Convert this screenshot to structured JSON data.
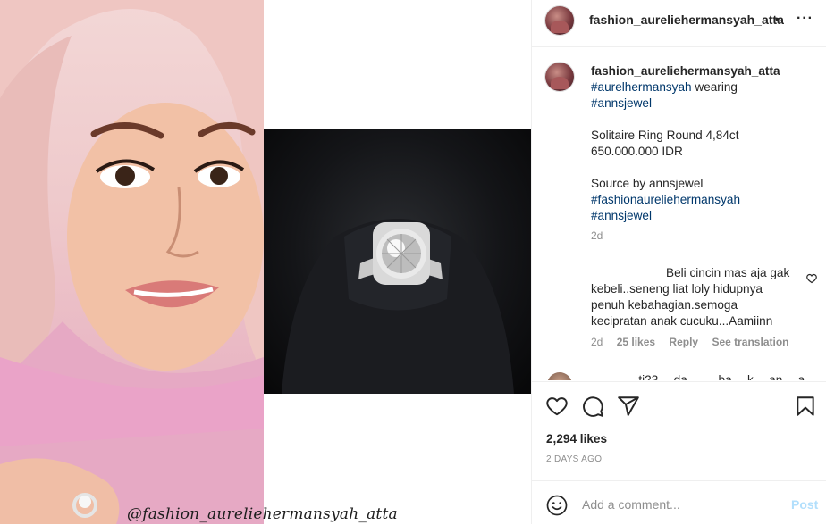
{
  "post": {
    "watermark": "@fashion_aureliehermansyah_atta"
  },
  "header": {
    "username": "fashion_aureliehermansyah_atta",
    "dot": "•",
    "more": "···"
  },
  "caption": {
    "username": "fashion_aureliehermansyah_atta",
    "line1_tag": "#aurelhermansyah",
    "line1_rest": " wearing",
    "line2_tag": "#annsjewel",
    "product": "Solitaire Ring Round 4,84ct",
    "price": "650.000.000 IDR",
    "source": "Source by annsjewel",
    "tag3": "#fashionaureliehermansyah",
    "tag4": "#annsjewel",
    "time": "2d"
  },
  "comment": {
    "line1": "Beli cincin mas aja gak",
    "line2": "kebeli..seneng liat loly hidupnya",
    "line3": "penuh kebahagian.semoga",
    "line4": "kecipratan anak cucuku...Aamiinn",
    "time": "2d",
    "likes": "25 likes",
    "reply": "Reply",
    "translate": "See translation",
    "next_preview": "…………ti23 …da … …ba …k …an …a"
  },
  "actions": {
    "likes": "2,294 likes",
    "date": "2 DAYS AGO"
  },
  "add_comment": {
    "placeholder": "Add a comment...",
    "post": "Post"
  },
  "icons": [
    "more-icon",
    "heart-icon",
    "comment-icon",
    "share-icon",
    "save-icon",
    "emoji-icon",
    "small-heart-icon"
  ],
  "colors": {
    "link": "#00376b",
    "muted": "#8e8e8e",
    "post_disabled": "#b2dffc",
    "border": "#efefef"
  }
}
